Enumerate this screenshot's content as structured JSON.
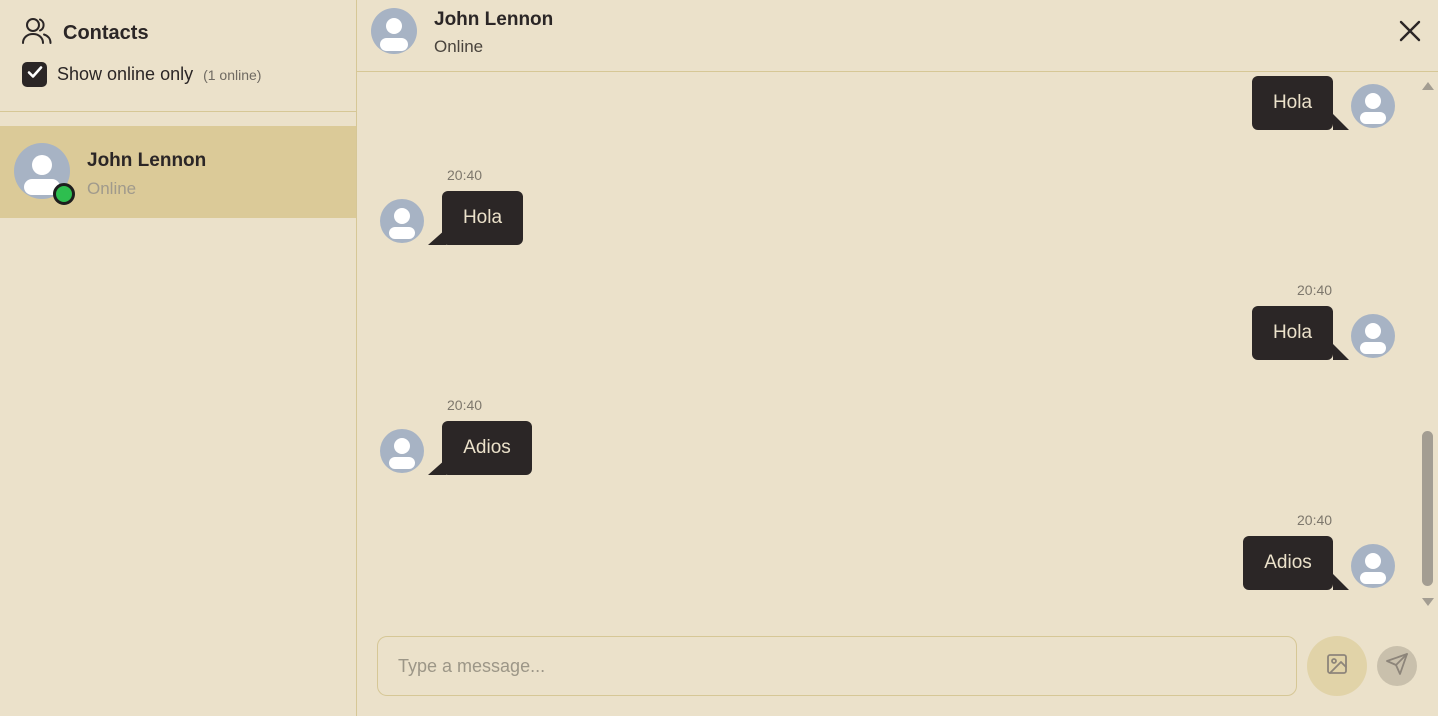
{
  "sidebar": {
    "title": "Contacts",
    "filter_label": "Show online only",
    "online_count": "(1 online)",
    "contacts": [
      {
        "name": "John Lennon",
        "status": "Online"
      }
    ]
  },
  "chat": {
    "name": "John Lennon",
    "status": "Online",
    "messages": [
      {
        "direction": "outgoing",
        "text": "Hola",
        "time": ""
      },
      {
        "direction": "incoming",
        "text": "Hola",
        "time": "20:40"
      },
      {
        "direction": "outgoing",
        "text": "Hola",
        "time": "20:40"
      },
      {
        "direction": "incoming",
        "text": "Adios",
        "time": "20:40"
      },
      {
        "direction": "outgoing",
        "text": "Adios",
        "time": "20:40"
      }
    ]
  },
  "composer": {
    "placeholder": "Type a message..."
  },
  "icons": {
    "contacts": "users-icon",
    "checkbox": "check-icon",
    "close": "close-icon",
    "image": "image-icon",
    "send": "send-icon"
  },
  "colors": {
    "background": "#ebe1ca",
    "selected_contact": "#dbca98",
    "bubble": "#2b2626",
    "online": "#2ebe4f",
    "avatar": "#a7b3c4"
  }
}
